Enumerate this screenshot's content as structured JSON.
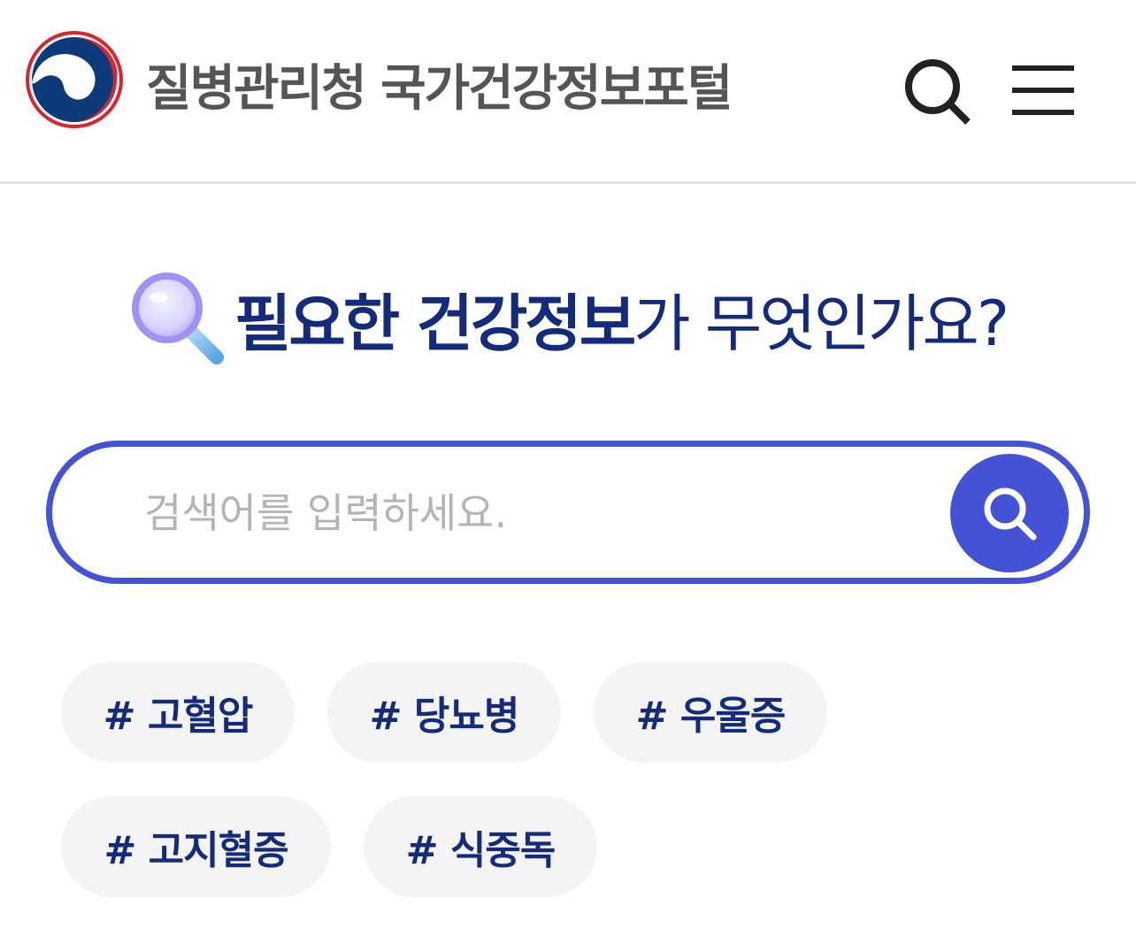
{
  "header": {
    "brand_title": "질병관리청 국가건강정보포털",
    "logo_icon": "taegeuk-emblem-icon",
    "search_icon": "search-icon",
    "menu_icon": "hamburger-menu-icon"
  },
  "headline": {
    "icon": "magnifier-glass-icon",
    "strong_text": "필요한 건강정보",
    "light_text": "가 무엇인가요?"
  },
  "search": {
    "placeholder": "검색어를 입력하세요.",
    "value": "",
    "submit_icon": "search-icon"
  },
  "tags": [
    {
      "label": "# 고혈압"
    },
    {
      "label": "# 당뇨병"
    },
    {
      "label": "# 우울증"
    },
    {
      "label": "# 고지혈증"
    },
    {
      "label": "# 식중독"
    }
  ],
  "colors": {
    "accent": "#4453d6",
    "navy_text": "#142a7a",
    "tag_background": "#f4f4f5",
    "logo_red": "#d9252f",
    "logo_blue": "#0d3b7a"
  }
}
